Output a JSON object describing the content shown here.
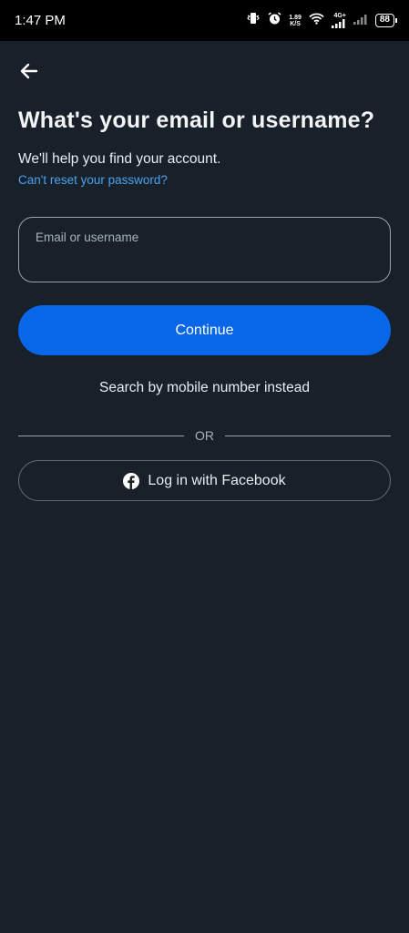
{
  "status_bar": {
    "time": "1:47 PM",
    "net_speed_value": "1.89",
    "net_speed_unit": "K/S",
    "network_type": "4G+",
    "battery": "88",
    "icons": [
      "vibrate-icon",
      "alarm-icon",
      "wifi-icon",
      "signal-icon",
      "signal-weak-icon",
      "battery-icon"
    ]
  },
  "header": {
    "back_icon": "back-arrow-icon",
    "title": "What's your email or username?",
    "subtitle": "We'll help you find your account.",
    "reset_link": "Can't reset your password?"
  },
  "form": {
    "email_label": "Email or username",
    "email_value": "",
    "continue_label": "Continue",
    "mobile_link": "Search by mobile number instead",
    "or_text": "OR",
    "facebook_label": "Log in with Facebook",
    "facebook_icon": "facebook-icon"
  },
  "colors": {
    "background": "#18212a",
    "primary_button": "#0866e8",
    "link": "#4aa2ee"
  }
}
